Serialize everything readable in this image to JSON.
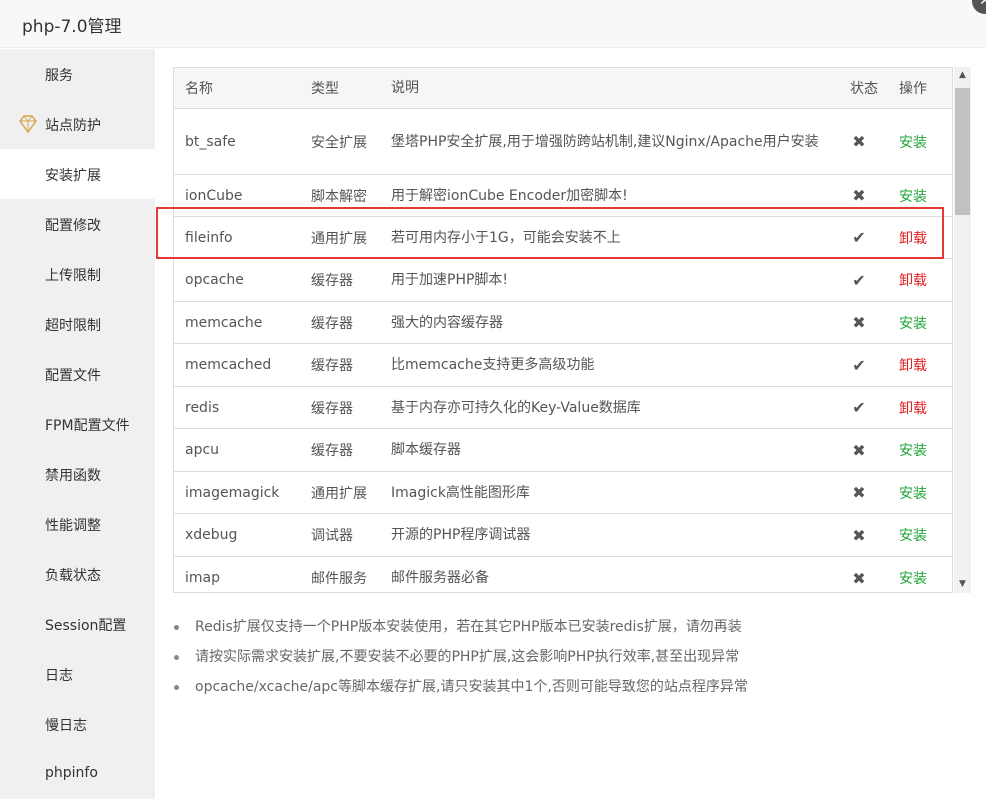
{
  "window": {
    "title": "php-7.0管理",
    "close_icon": "✕"
  },
  "sidebar": {
    "items": [
      {
        "label": "服务"
      },
      {
        "label": "站点防护"
      },
      {
        "label": "安装扩展"
      },
      {
        "label": "配置修改"
      },
      {
        "label": "上传限制"
      },
      {
        "label": "超时限制"
      },
      {
        "label": "配置文件"
      },
      {
        "label": "FPM配置文件"
      },
      {
        "label": "禁用函数"
      },
      {
        "label": "性能调整"
      },
      {
        "label": "负载状态"
      },
      {
        "label": "Session配置"
      },
      {
        "label": "日志"
      },
      {
        "label": "慢日志"
      },
      {
        "label": "phpinfo"
      }
    ],
    "active_index": 2
  },
  "table": {
    "headers": {
      "name": "名称",
      "type": "类型",
      "desc": "说明",
      "status": "状态",
      "op": "操作"
    },
    "rows": [
      {
        "name": "bt_safe",
        "type": "安全扩展",
        "desc": "堡塔PHP安全扩展,用于增强防跨站机制,建议Nginx/Apache用户安装",
        "status": "✖",
        "op": "安装"
      },
      {
        "name": "ionCube",
        "type": "脚本解密",
        "desc": "用于解密ionCube Encoder加密脚本!",
        "status": "✖",
        "op": "安装"
      },
      {
        "name": "fileinfo",
        "type": "通用扩展",
        "desc": "若可用内存小于1G，可能会安装不上",
        "status": "✔",
        "op": "卸载"
      },
      {
        "name": "opcache",
        "type": "缓存器",
        "desc": "用于加速PHP脚本!",
        "status": "✔",
        "op": "卸载"
      },
      {
        "name": "memcache",
        "type": "缓存器",
        "desc": "强大的内容缓存器",
        "status": "✖",
        "op": "安装"
      },
      {
        "name": "memcached",
        "type": "缓存器",
        "desc": "比memcache支持更多高级功能",
        "status": "✔",
        "op": "卸载"
      },
      {
        "name": "redis",
        "type": "缓存器",
        "desc": "基于内存亦可持久化的Key-Value数据库",
        "status": "✔",
        "op": "卸载"
      },
      {
        "name": "apcu",
        "type": "缓存器",
        "desc": "脚本缓存器",
        "status": "✖",
        "op": "安装"
      },
      {
        "name": "imagemagick",
        "type": "通用扩展",
        "desc": "Imagick高性能图形库",
        "status": "✖",
        "op": "安装"
      },
      {
        "name": "xdebug",
        "type": "调试器",
        "desc": "开源的PHP程序调试器",
        "status": "✖",
        "op": "安装"
      },
      {
        "name": "imap",
        "type": "邮件服务",
        "desc": "邮件服务器必备",
        "status": "✖",
        "op": "安装"
      }
    ]
  },
  "notes": [
    "Redis扩展仅支持一个PHP版本安装使用，若在其它PHP版本已安装redis扩展，请勿再装",
    "请按实际需求安装扩展,不要安装不必要的PHP扩展,这会影响PHP执行效率,甚至出现异常",
    "opcache/xcache/apc等脚本缓存扩展,请只安装其中1个,否则可能导致您的站点程序异常"
  ],
  "colors": {
    "install": "#20a53a",
    "uninstall": "#e02020",
    "highlight": "#e53935"
  }
}
